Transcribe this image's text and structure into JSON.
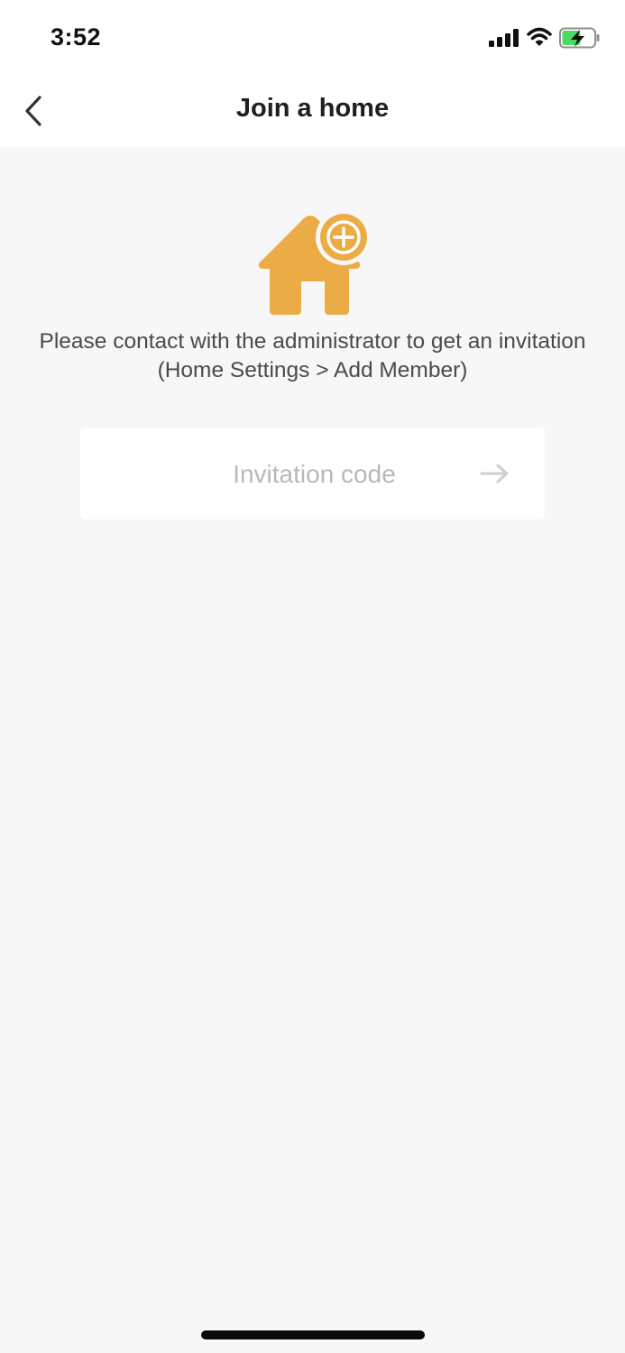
{
  "status_bar": {
    "time": "3:52",
    "icons": [
      "cellular-signal-icon",
      "wifi-icon",
      "battery-charging-icon"
    ]
  },
  "nav": {
    "back_icon": "chevron-left-icon",
    "title": "Join a home"
  },
  "illustration": {
    "icon": "house-add-icon",
    "color": "#ebab45"
  },
  "instructions": {
    "text": "Please contact with the administrator to get an invitation (Home Settings > Add Member)"
  },
  "invitation": {
    "placeholder": "Invitation code",
    "value": "",
    "submit_icon": "arrow-right-icon"
  },
  "colors": {
    "accent": "#ebab45",
    "background": "#f7f7f7",
    "surface": "#ffffff",
    "placeholder": "#b8b8b8"
  }
}
